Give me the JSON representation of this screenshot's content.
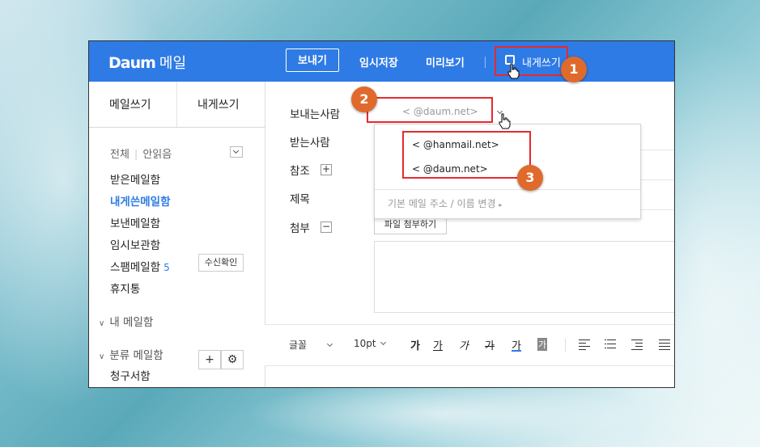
{
  "app": {
    "logo_brand": "Daum",
    "logo_service": "메일"
  },
  "topbar": {
    "send_label": "보내기",
    "draft_label": "임시저장",
    "preview_label": "미리보기",
    "self_mail_label": "내게쓰기",
    "background_color": "#2f7be5"
  },
  "sidebar": {
    "tab_compose": "메일쓰기",
    "tab_self": "내게쓰기",
    "filter_all": "전체",
    "filter_unread": "안읽음",
    "mailboxes": [
      {
        "label": "받은메일함",
        "active": false,
        "count": ""
      },
      {
        "label": "내게쓴메일함",
        "active": true,
        "count": ""
      },
      {
        "label": "보낸메일함",
        "active": false,
        "count": ""
      },
      {
        "label": "임시보관함",
        "active": false,
        "count": ""
      },
      {
        "label": "스팸메일함",
        "active": false,
        "count": "5"
      },
      {
        "label": "휴지통",
        "active": false,
        "count": ""
      }
    ],
    "receipt_check_label": "수신확인",
    "my_mailbox_label": "내 메일함",
    "category_label": "분류 메일함",
    "category_items": [
      "청구서함"
    ]
  },
  "compose": {
    "sender_label": "보내는사람",
    "sender_value": "<      @daum.net>",
    "recipient_label": "받는사람",
    "cc_label": "참조",
    "subject_label": "제목",
    "attach_label": "첨부",
    "attach_button": "파일 첨부하기",
    "sender_options": [
      "<        @hanmail.net>",
      "<        @daum.net>"
    ],
    "change_default_label": "기본 메일 주소 / 이름 변경"
  },
  "editor": {
    "font_label": "글꼴",
    "size_label": "10pt",
    "format_buttons": [
      "가",
      "가",
      "가",
      "가",
      "가",
      "가"
    ]
  },
  "annotations": {
    "badges": [
      "1",
      "2",
      "3"
    ],
    "highlight_color": "#e8292b",
    "badge_color": "#e06a2c"
  }
}
